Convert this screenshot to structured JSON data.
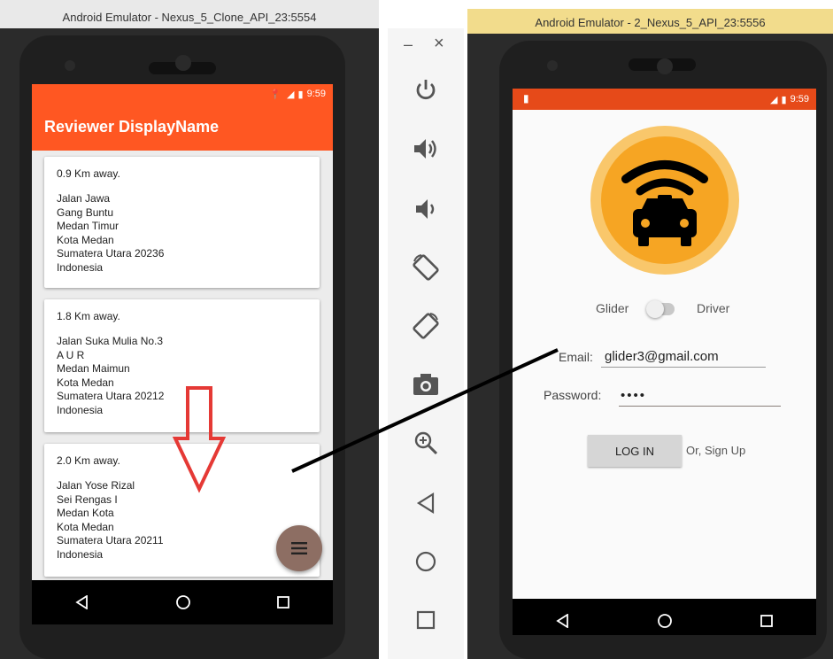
{
  "left_window": {
    "title": "Android Emulator - Nexus_5_Clone_API_23:5554",
    "status": {
      "time": "9:59"
    },
    "appbar_title": "Reviewer DisplayName",
    "cards": [
      {
        "distance": "0.9 Km away.",
        "address": [
          "Jalan Jawa",
          "Gang Buntu",
          "Medan Timur",
          "Kota Medan",
          "Sumatera Utara 20236",
          "Indonesia"
        ]
      },
      {
        "distance": "1.8 Km away.",
        "address": [
          "Jalan Suka Mulia No.3",
          "A U R",
          "Medan Maimun",
          "Kota Medan",
          "Sumatera Utara 20212",
          "Indonesia"
        ]
      },
      {
        "distance": "2.0 Km away.",
        "address": [
          "Jalan Yose Rizal",
          "Sei Rengas I",
          "Medan Kota",
          "Kota Medan",
          "Sumatera Utara 20211",
          "Indonesia"
        ]
      }
    ]
  },
  "right_window": {
    "title": "Android Emulator - 2_Nexus_5_API_23:5556",
    "status": {
      "time": "9:59"
    },
    "toggle": {
      "left_label": "Glider",
      "right_label": "Driver"
    },
    "email": {
      "label": "Email:",
      "value": "glider3@gmail.com"
    },
    "password": {
      "label": "Password:",
      "value": "••••"
    },
    "login_button": "LOG IN",
    "signup_link": "Or, Sign Up"
  },
  "emulator_toolbar": {
    "minimize": "–",
    "close": "×",
    "tools": [
      "power-icon",
      "volume-up-icon",
      "volume-down-icon",
      "rotate-left-icon",
      "rotate-right-icon",
      "camera-icon",
      "zoom-icon",
      "back-icon",
      "home-icon",
      "overview-icon"
    ]
  },
  "colors": {
    "accent": "#ff5722",
    "status_bar": "#e64a19",
    "logo_outer": "#f9c76b",
    "logo_inner": "#f6a523",
    "fab": "#8d6e63",
    "arrow": "#e53935",
    "right_frame": "#f2dc8c"
  }
}
